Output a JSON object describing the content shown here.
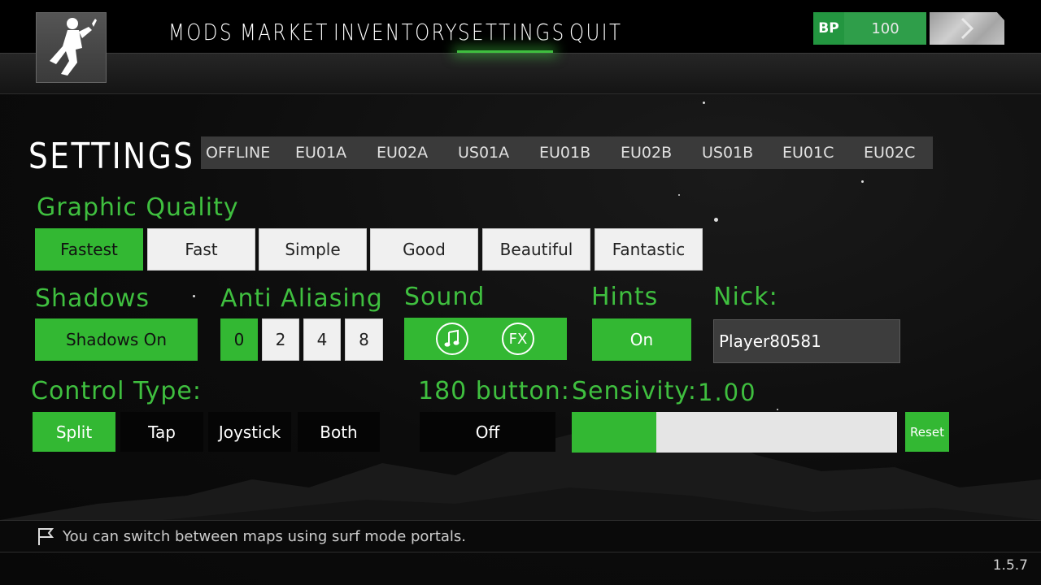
{
  "nav": {
    "items": [
      "MODS",
      "MARKET",
      "INVENTORY",
      "SETTINGS",
      "QUIT"
    ],
    "active": "SETTINGS"
  },
  "currency": {
    "label": "BP",
    "value": "100"
  },
  "page": {
    "title": "SETTINGS"
  },
  "servers": [
    "OFFLINE",
    "EU01A",
    "EU02A",
    "US01A",
    "EU01B",
    "EU02B",
    "US01B",
    "EU01C",
    "EU02C"
  ],
  "graphic_quality": {
    "label": "Graphic Quality",
    "options": [
      "Fastest",
      "Fast",
      "Simple",
      "Good",
      "Beautiful",
      "Fantastic"
    ],
    "selected": "Fastest"
  },
  "shadows": {
    "label": "Shadows",
    "value": "Shadows On"
  },
  "anti_aliasing": {
    "label": "Anti Aliasing",
    "options": [
      "0",
      "2",
      "4",
      "8"
    ],
    "selected": "0"
  },
  "sound": {
    "label": "Sound",
    "music_icon": "music-note-icon",
    "fx_label": "FX"
  },
  "hints": {
    "label": "Hints",
    "value": "On"
  },
  "nick": {
    "label": "Nick:",
    "value": "Player80581"
  },
  "control_type": {
    "label": "Control Type:",
    "options": [
      "Split",
      "Tap",
      "Joystick",
      "Both"
    ],
    "selected": "Split"
  },
  "button_180": {
    "label": "180 button:",
    "value": "Off"
  },
  "sensitivity": {
    "label": "Sensivity:",
    "value": "1.00",
    "fill_fraction": 0.26,
    "reset_label": "Reset"
  },
  "hint": {
    "text": "You can switch between maps using surf mode portals."
  },
  "version": "1.5.7",
  "colors": {
    "accent": "#33b833",
    "accent_text": "#3fbf3f",
    "bp_green": "#2f9e4a"
  }
}
